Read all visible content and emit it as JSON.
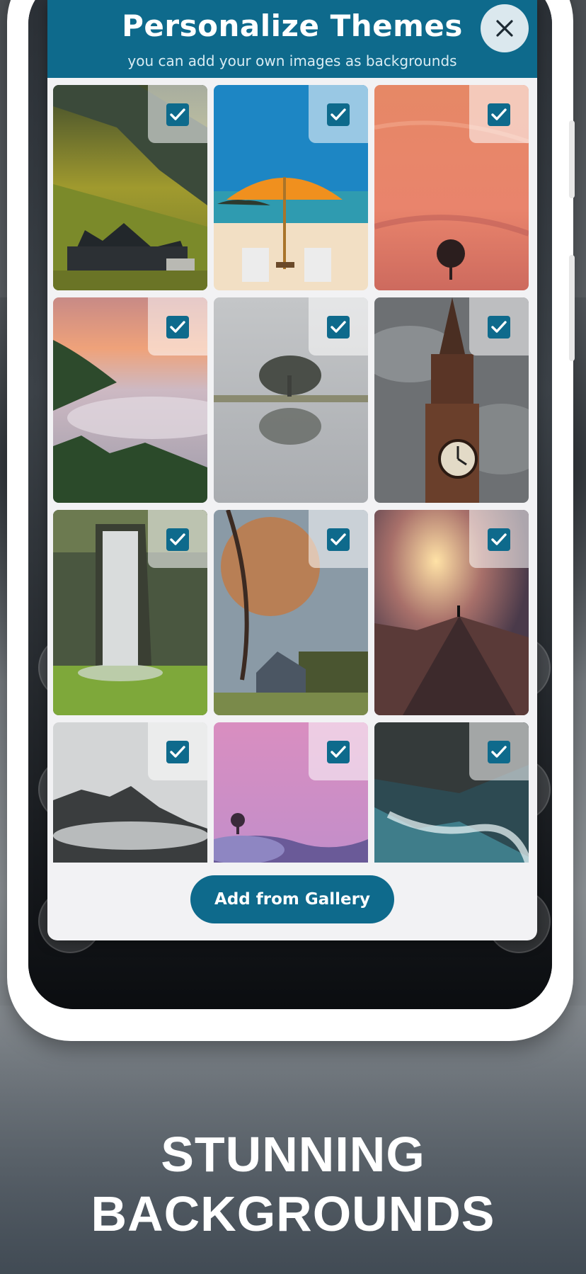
{
  "modal": {
    "title": "Personalize Themes",
    "subtitle": "you can add your own images as backgrounds",
    "close_icon": "close-icon",
    "add_button_label": "Add from Gallery"
  },
  "tiles": [
    {
      "name": "mountain-cabin",
      "selected": true
    },
    {
      "name": "beach-umbrella",
      "selected": true
    },
    {
      "name": "sunset-tree",
      "selected": true
    },
    {
      "name": "misty-valley",
      "selected": true
    },
    {
      "name": "tree-reflection",
      "selected": true
    },
    {
      "name": "clock-tower",
      "selected": true
    },
    {
      "name": "waterfall",
      "selected": true
    },
    {
      "name": "autumn-tree-barn",
      "selected": true
    },
    {
      "name": "mountain-summit-sunrise",
      "selected": true
    },
    {
      "name": "foggy-peaks",
      "selected": true
    },
    {
      "name": "pink-sky-hill",
      "selected": true
    },
    {
      "name": "aerial-coast",
      "selected": true
    }
  ],
  "headline": {
    "line1": "STUNNING",
    "line2": "BACKGROUNDS"
  },
  "colors": {
    "accent": "#0e6a8c",
    "check": "#0e6a8c"
  }
}
